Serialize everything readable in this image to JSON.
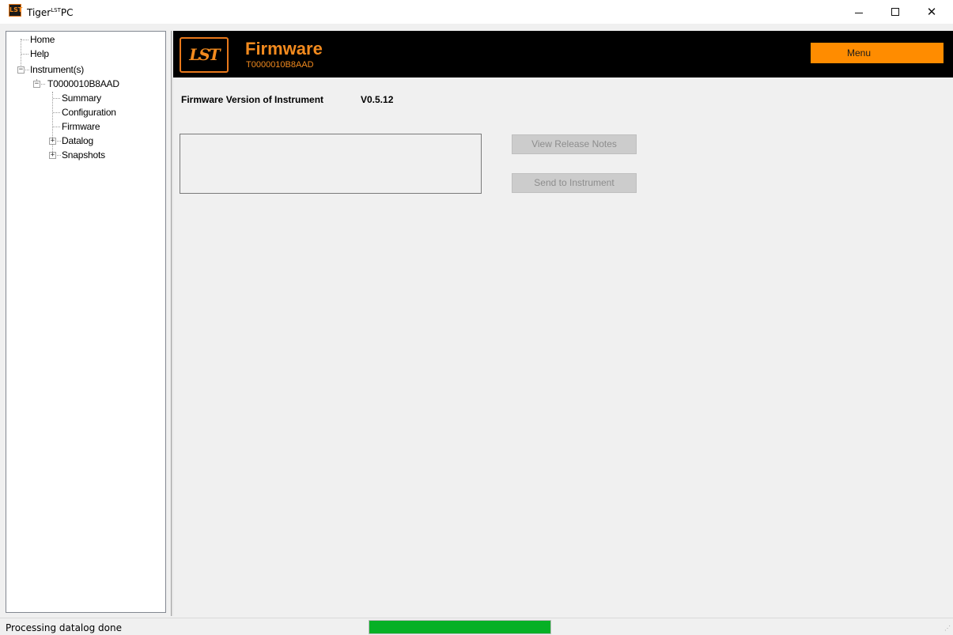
{
  "window": {
    "app_icon_text": "LST",
    "title_main": "Tiger",
    "title_sup": "LST",
    "title_end": "PC",
    "minimize_icon": "minimize-icon",
    "maximize_icon": "maximize-icon",
    "close_icon": "close-icon",
    "close_glyph": "✕"
  },
  "tree": {
    "items": [
      {
        "label": "Home"
      },
      {
        "label": "Help"
      },
      {
        "label": "Instrument(s)"
      },
      {
        "label": "T0000010B8AAD"
      },
      {
        "label": "Summary"
      },
      {
        "label": "Configuration"
      },
      {
        "label": "Firmware"
      },
      {
        "label": "Datalog"
      },
      {
        "label": "Snapshots"
      }
    ],
    "expander_minus": "−",
    "expander_plus": "+"
  },
  "header": {
    "logo_text": "LST",
    "title": "Firmware",
    "subtitle": "T0000010B8AAD",
    "menu_label": "Menu"
  },
  "firmware": {
    "version_label": "Firmware Version of Instrument",
    "version_value": "V0.5.12",
    "release_notes_button": "View Release Notes",
    "send_button": "Send to Instrument"
  },
  "status": {
    "text": "Processing datalog done",
    "progress_fraction": 1.0,
    "progress_color": "#06b025",
    "grip_glyph": "⋰"
  },
  "colors": {
    "accent_orange": "#f28a1e",
    "menu_orange": "#ff8c00",
    "banner_black": "#000000"
  }
}
